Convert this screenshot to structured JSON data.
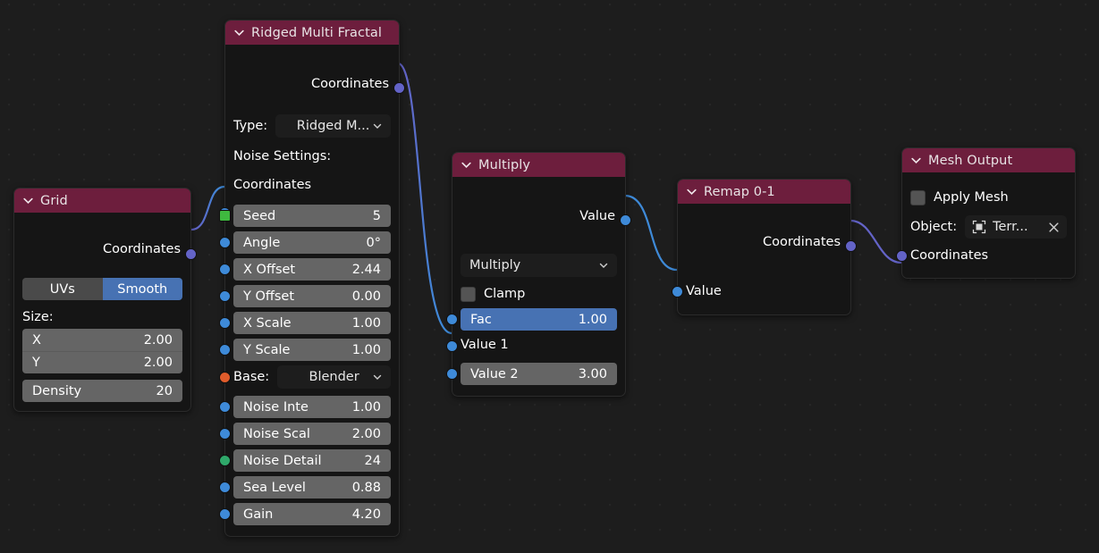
{
  "editor": {
    "name": "node-editor",
    "background": "#1d1d1d",
    "grid_dot_color": "#262626"
  },
  "colors": {
    "header": "#6d1e3d",
    "node_body": "#151515",
    "field": "#656565",
    "accent_blue": "#4772b3",
    "socket_vector": "#6363c7",
    "socket_value": "#3e8ad8",
    "socket_int": "#2fa86a",
    "socket_green_sq": "#3fb93f",
    "socket_string": "#e05c2b"
  },
  "nodes": {
    "grid": {
      "title": "Grid",
      "outputs": [
        {
          "label": "Coordinates",
          "socket": "vector"
        }
      ],
      "toggle": {
        "left": "UVs",
        "right": "Smooth",
        "active": "right"
      },
      "size_label": "Size:",
      "size": [
        {
          "label": "X",
          "value": "2.00"
        },
        {
          "label": "Y",
          "value": "2.00"
        }
      ],
      "density": {
        "label": "Density",
        "value": "20"
      }
    },
    "ridged": {
      "title": "Ridged Multi Fractal",
      "outputs": [
        {
          "label": "Coordinates",
          "socket": "vector"
        }
      ],
      "type_label": "Type:",
      "type_value": "Ridged M...",
      "noise_settings_label": "Noise Settings:",
      "coordinates_input": "Coordinates",
      "base_label": "Base:",
      "base_value": "Blender",
      "params": [
        {
          "label": "Seed",
          "value": "5",
          "socket": "green_sq"
        },
        {
          "label": "Angle",
          "value": "0°",
          "socket": "value"
        },
        {
          "label": "X Offset",
          "value": "2.44",
          "socket": "value"
        },
        {
          "label": "Y Offset",
          "value": "0.00",
          "socket": "value"
        },
        {
          "label": "X Scale",
          "value": "1.00",
          "socket": "value"
        },
        {
          "label": "Y Scale",
          "value": "1.00",
          "socket": "value"
        }
      ],
      "params2": [
        {
          "label": "Noise Inte",
          "value": "1.00",
          "socket": "value"
        },
        {
          "label": "Noise Scal",
          "value": "2.00",
          "socket": "value"
        },
        {
          "label": "Noise Detail",
          "value": "24",
          "socket": "int"
        },
        {
          "label": "Sea Level",
          "value": "0.88",
          "socket": "value"
        },
        {
          "label": "Gain",
          "value": "4.20",
          "socket": "value"
        }
      ]
    },
    "multiply": {
      "title": "Multiply",
      "outputs": [
        {
          "label": "Value",
          "socket": "value"
        }
      ],
      "operation": "Multiply",
      "clamp_label": "Clamp",
      "clamp_checked": false,
      "fac": {
        "label": "Fac",
        "value": "1.00"
      },
      "value1_label": "Value 1",
      "value2": {
        "label": "Value 2",
        "value": "3.00"
      }
    },
    "remap": {
      "title": "Remap 0-1",
      "outputs": [
        {
          "label": "Coordinates",
          "socket": "vector"
        }
      ],
      "inputs": [
        {
          "label": "Value",
          "socket": "value"
        }
      ]
    },
    "mesh_output": {
      "title": "Mesh Output",
      "apply_mesh_label": "Apply Mesh",
      "apply_mesh_checked": false,
      "object_label": "Object:",
      "object_value": "Terr...",
      "object_icon": "mesh-object-icon",
      "clear_icon": "close-icon",
      "inputs": [
        {
          "label": "Coordinates",
          "socket": "vector"
        }
      ]
    }
  },
  "links": [
    {
      "from": "grid.Coordinates",
      "to": "ridged.Coordinates"
    },
    {
      "from": "ridged.Coordinates",
      "to": "multiply.Value 1"
    },
    {
      "from": "multiply.Value",
      "to": "remap.Value"
    },
    {
      "from": "remap.Coordinates",
      "to": "mesh_output.Coordinates"
    }
  ]
}
